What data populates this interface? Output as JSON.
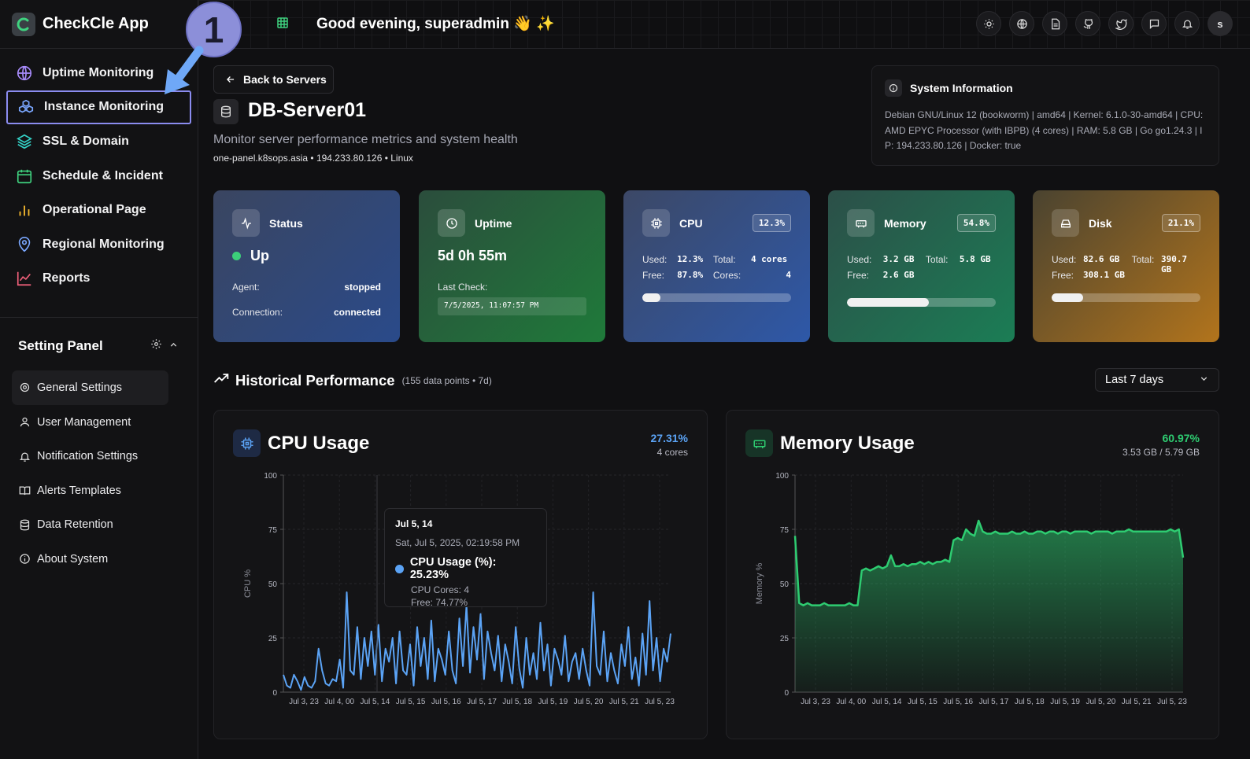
{
  "app": {
    "name": "CheckCle App"
  },
  "topbar": {
    "greeting": "Good evening, superadmin 👋 ✨",
    "avatar_letter": "s"
  },
  "annotation": {
    "step": "1"
  },
  "nav": [
    {
      "label": "Uptime Monitoring",
      "icon": "globe-icon"
    },
    {
      "label": "Instance Monitoring",
      "icon": "cubes-icon",
      "active": true
    },
    {
      "label": "SSL & Domain",
      "icon": "layers-icon"
    },
    {
      "label": "Schedule & Incident",
      "icon": "calendar-icon"
    },
    {
      "label": "Operational Page",
      "icon": "bars-icon"
    },
    {
      "label": "Regional Monitoring",
      "icon": "map-pin-icon"
    },
    {
      "label": "Reports",
      "icon": "line-chart-icon"
    }
  ],
  "settings": {
    "title": "Setting Panel",
    "items": [
      {
        "label": "General Settings",
        "icon": "gear-icon"
      },
      {
        "label": "User Management",
        "icon": "user-icon"
      },
      {
        "label": "Notification Settings",
        "icon": "bell-icon"
      },
      {
        "label": "Alerts Templates",
        "icon": "book-icon"
      },
      {
        "label": "Data Retention",
        "icon": "database-icon"
      },
      {
        "label": "About System",
        "icon": "info-icon"
      }
    ]
  },
  "server": {
    "back_label": "Back to Servers",
    "name": "DB-Server01",
    "subtitle": "Monitor server performance metrics and system health",
    "meta": "one-panel.k8sops.asia • 194.233.80.126 • Linux"
  },
  "sysinfo": {
    "title": "System Information",
    "text": "Debian GNU/Linux 12 (bookworm) | amd64 | Kernel: 6.1.0-30-amd64 | CPU: AMD EPYC Processor (with IBPB) (4 cores) | RAM: 5.8 GB | Go go1.24.3 | IP: 194.233.80.126 | Docker: true"
  },
  "cards": {
    "status": {
      "title": "Status",
      "value": "Up",
      "agent_label": "Agent:",
      "agent_value": "stopped",
      "conn_label": "Connection:",
      "conn_value": "connected",
      "dot_color": "#3cd07a"
    },
    "uptime": {
      "title": "Uptime",
      "value": "5d 0h 55m",
      "last_check_label": "Last Check:",
      "last_check_value": "7/5/2025, 11:07:57 PM"
    },
    "cpu": {
      "title": "CPU",
      "pct": "12.3%",
      "used_label": "Used:",
      "used": "12.3%",
      "total_label": "Total:",
      "total": "4 cores",
      "free_label": "Free:",
      "free": "87.8%",
      "cores_label": "Cores:",
      "cores": "4",
      "level": 0.123
    },
    "memory": {
      "title": "Memory",
      "pct": "54.8%",
      "used_label": "Used:",
      "used": "3.2 GB",
      "total_label": "Total:",
      "total": "5.8 GB",
      "free_label": "Free:",
      "free": "2.6 GB",
      "level": 0.548
    },
    "disk": {
      "title": "Disk",
      "pct": "21.1%",
      "used_label": "Used:",
      "used": "82.6 GB",
      "total_label": "Total:",
      "total": "390.7 GB",
      "free_label": "Free:",
      "free": "308.1 GB",
      "level": 0.211
    }
  },
  "historical": {
    "title": "Historical Performance",
    "sub": "(155 data points • 7d)",
    "range": "Last 7 days"
  },
  "cpu_panel": {
    "title": "CPU Usage",
    "stat": "27.31%",
    "sub": "4 cores",
    "accent": "#5ba3f5"
  },
  "mem_panel": {
    "title": "Memory Usage",
    "stat": "60.97%",
    "sub": "3.53 GB / 5.79 GB",
    "accent": "#2ecc71"
  },
  "tooltip": {
    "date": "Jul 5, 14",
    "timestamp": "Sat, Jul 5, 2025, 02:19:58 PM",
    "value": "CPU Usage (%): 25.23%",
    "cores": "CPU Cores: 4",
    "free": "Free: 74.77%"
  },
  "chart_data": [
    {
      "type": "line",
      "title": "CPU Usage",
      "ylabel": "CPU %",
      "ylim": [
        0,
        100
      ],
      "yticks": [
        0,
        25,
        50,
        75,
        100
      ],
      "xticks": [
        "Jul 3, 23",
        "Jul 4, 00",
        "Jul 5, 14",
        "Jul 5, 15",
        "Jul 5, 16",
        "Jul 5, 17",
        "Jul 5, 18",
        "Jul 5, 19",
        "Jul 5, 20",
        "Jul 5, 21",
        "Jul 5, 23"
      ],
      "series": [
        {
          "values": [
            8,
            3,
            2,
            8,
            5,
            1,
            7,
            3,
            2,
            5,
            20,
            10,
            4,
            3,
            6,
            5,
            15,
            2,
            46,
            10,
            8,
            30,
            6,
            25,
            12,
            28,
            8,
            31,
            5,
            20,
            14,
            25,
            4,
            28,
            10,
            8,
            22,
            3,
            30,
            12,
            25,
            6,
            33,
            5,
            20,
            15,
            8,
            28,
            10,
            4,
            34,
            12,
            40,
            9,
            30,
            15,
            36,
            6,
            28,
            18,
            10,
            26,
            5,
            22,
            14,
            4,
            30,
            11,
            2,
            25,
            8,
            18,
            6,
            32,
            10,
            22,
            3,
            20,
            15,
            8,
            26,
            5,
            14,
            18,
            6,
            20,
            10,
            3,
            46,
            12,
            8,
            28,
            5,
            18,
            10,
            4,
            22,
            12,
            30,
            6,
            16,
            3,
            27,
            8,
            42,
            10,
            25,
            5,
            20,
            14,
            27
          ]
        }
      ]
    },
    {
      "type": "area",
      "title": "Memory Usage",
      "ylabel": "Memory %",
      "ylim": [
        0,
        100
      ],
      "yticks": [
        0,
        25,
        50,
        75,
        100
      ],
      "xticks": [
        "Jul 3, 23",
        "Jul 4, 00",
        "Jul 5, 14",
        "Jul 5, 15",
        "Jul 5, 16",
        "Jul 5, 17",
        "Jul 5, 18",
        "Jul 5, 19",
        "Jul 5, 20",
        "Jul 5, 21",
        "Jul 5, 23"
      ],
      "series": [
        {
          "values": [
            72,
            41,
            40,
            41,
            40,
            40,
            40,
            41,
            40,
            40,
            40,
            40,
            40,
            41,
            40,
            40,
            56,
            57,
            56,
            57,
            58,
            57,
            58,
            63,
            58,
            58,
            59,
            58,
            59,
            59,
            60,
            59,
            60,
            59,
            60,
            60,
            61,
            60,
            70,
            71,
            70,
            75,
            73,
            72,
            79,
            74,
            73,
            73,
            74,
            73,
            73,
            73,
            74,
            73,
            73,
            74,
            73,
            73,
            74,
            74,
            73,
            74,
            74,
            73,
            74,
            74,
            73,
            74,
            74,
            74,
            74,
            73,
            74,
            74,
            74,
            74,
            73,
            74,
            74,
            74,
            75,
            74,
            74,
            74,
            74,
            74,
            74,
            74,
            74,
            74,
            75,
            74,
            75,
            62
          ]
        }
      ]
    }
  ]
}
